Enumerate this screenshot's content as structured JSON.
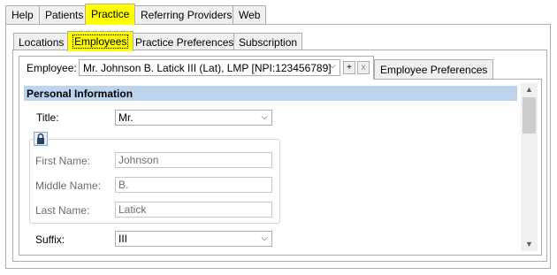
{
  "top_tabs": [
    {
      "label": "Help"
    },
    {
      "label": "Patients"
    },
    {
      "label": "Practice",
      "active": true
    },
    {
      "label": "Referring Providers"
    },
    {
      "label": "Web"
    }
  ],
  "sub_tabs": [
    {
      "label": "Locations"
    },
    {
      "label": "Employees",
      "active": true
    },
    {
      "label": "Practice Preferences"
    },
    {
      "label": "Subscription"
    }
  ],
  "employee": {
    "label": "Employee:",
    "selected": "Mr. Johnson B. Latick III (Lat), LMP [NPI:123456789]",
    "add_button": "+",
    "remove_button": "x",
    "preferences_tab": "Employee Preferences"
  },
  "personal_info": {
    "header": "Personal Information",
    "title_label": "Title:",
    "title_value": "Mr.",
    "first_name_label": "First Name:",
    "first_name_value": "Johnson",
    "middle_name_label": "Middle Name:",
    "middle_name_value": "B.",
    "last_name_label": "Last Name:",
    "last_name_value": "Latick",
    "suffix_label": "Suffix:",
    "suffix_value": "III"
  },
  "icons": {
    "lock": "lock-icon",
    "chevron": "chevron-down-icon",
    "scroll_up": "scroll-up-arrow-icon",
    "scroll_down": "scroll-down-arrow-icon"
  },
  "colors": {
    "highlight": "#ffff00",
    "section_header": "#bcd4ee",
    "tab_bg": "#f0f0f0",
    "border": "#adadad"
  }
}
